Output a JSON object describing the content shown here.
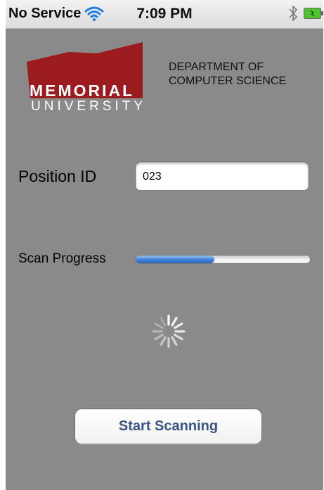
{
  "status_bar": {
    "carrier": "No Service",
    "time": "7:09 PM",
    "wifi_icon": "wifi-icon",
    "bluetooth_icon": "bluetooth-icon",
    "battery_icon": "battery-charging-icon"
  },
  "logo": {
    "line1": "MEMORIAL",
    "line2": "UNIVERSITY",
    "color": "#9b1b1f"
  },
  "department": {
    "line1": "DEPARTMENT OF",
    "line2": "COMPUTER SCIENCE"
  },
  "position": {
    "label": "Position ID",
    "value": "023"
  },
  "scan": {
    "label": "Scan Progress",
    "progress": 0.45,
    "spinner_icon": "activity-spinner-icon"
  },
  "actions": {
    "start_label": "Start Scanning"
  },
  "colors": {
    "background": "#8a8a8a",
    "button_text": "#3a5382",
    "progress_fill": "#3f7fd6"
  }
}
